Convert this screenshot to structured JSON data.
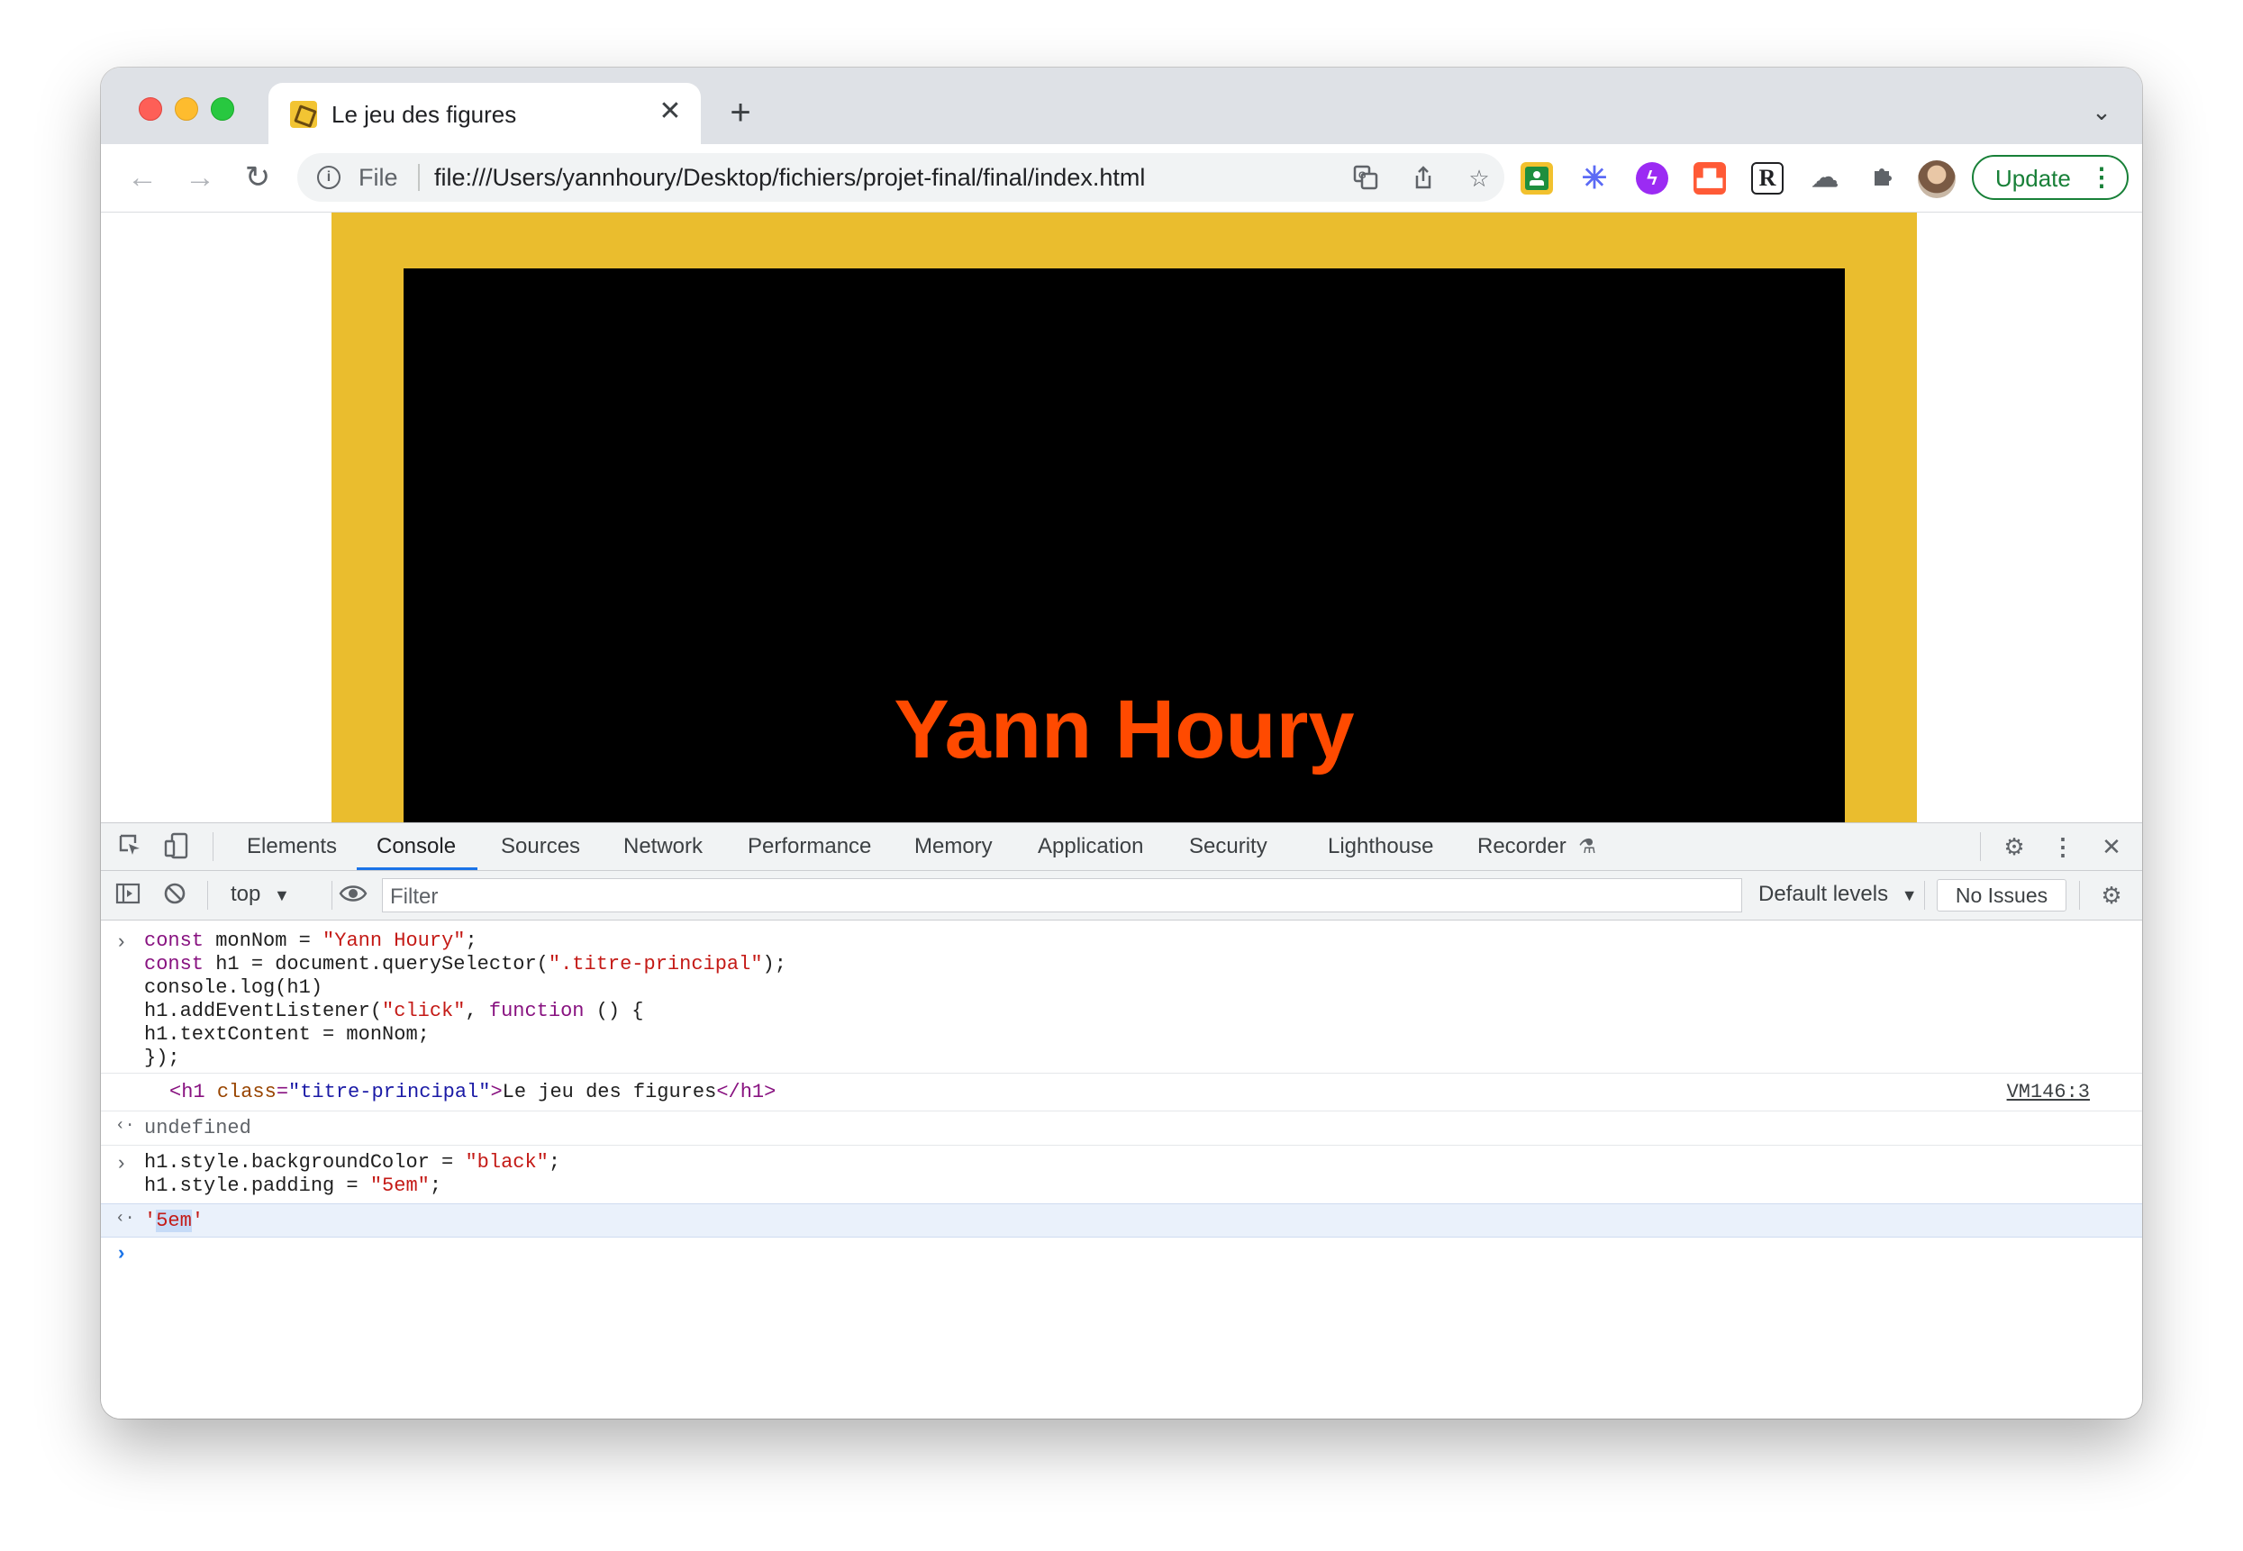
{
  "browser": {
    "tab_title": "Le jeu des figures",
    "omnibox": {
      "scheme_label": "File",
      "url": "file:///Users/yannhoury/Desktop/fichiers/projet-final/final/index.html"
    },
    "update_label": "Update"
  },
  "page": {
    "heading": "Yann Houry",
    "frame_color": "#eabd2e",
    "panel_color": "#000000",
    "heading_color": "#ff4a00"
  },
  "devtools": {
    "tabs": [
      "Elements",
      "Console",
      "Sources",
      "Network",
      "Performance",
      "Memory",
      "Application",
      "Security",
      "Lighthouse",
      "Recorder"
    ],
    "active_tab": "Console",
    "context": "top",
    "filter_placeholder": "Filter",
    "levels": "Default levels",
    "issues": "No Issues",
    "source_link": "VM146:3",
    "undefined_text": "undefined"
  },
  "icons": {
    "tab_close": "close-icon",
    "new_tab": "plus-icon",
    "reload": "reload-icon",
    "info": "info-icon",
    "settings": "gear-icon"
  }
}
